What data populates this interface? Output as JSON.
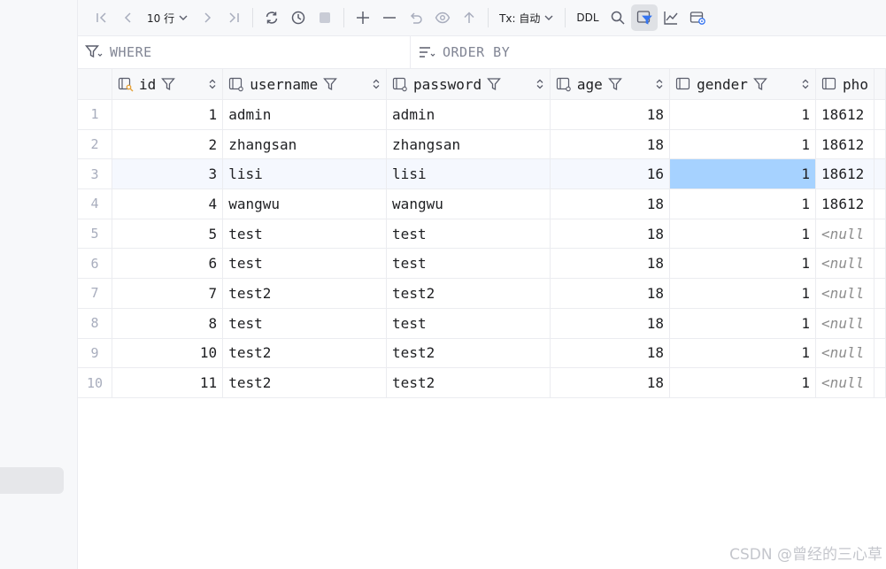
{
  "toolbar": {
    "page_size_label": "10 行",
    "tx_label": "Tx: 自动",
    "ddl_label": "DDL"
  },
  "filters": {
    "where_label": "WHERE",
    "order_by_label": "ORDER BY"
  },
  "table": {
    "columns": [
      {
        "name": "id",
        "key": true
      },
      {
        "name": "username"
      },
      {
        "name": "password"
      },
      {
        "name": "age"
      },
      {
        "name": "gender"
      },
      {
        "name": "pho"
      }
    ],
    "rows": [
      {
        "row": "1",
        "id": "1",
        "username": "admin",
        "password": "admin",
        "age": "18",
        "gender": "1",
        "phone": "18612"
      },
      {
        "row": "2",
        "id": "2",
        "username": "zhangsan",
        "password": "zhangsan",
        "age": "18",
        "gender": "1",
        "phone": "18612"
      },
      {
        "row": "3",
        "id": "3",
        "username": "lisi",
        "password": "lisi",
        "age": "16",
        "gender": "1",
        "phone": "18612"
      },
      {
        "row": "4",
        "id": "4",
        "username": "wangwu",
        "password": "wangwu",
        "age": "18",
        "gender": "1",
        "phone": "18612"
      },
      {
        "row": "5",
        "id": "5",
        "username": "test",
        "password": "test",
        "age": "18",
        "gender": "1",
        "phone": "<null"
      },
      {
        "row": "6",
        "id": "6",
        "username": "test",
        "password": "test",
        "age": "18",
        "gender": "1",
        "phone": "<null"
      },
      {
        "row": "7",
        "id": "7",
        "username": "test2",
        "password": "test2",
        "age": "18",
        "gender": "1",
        "phone": "<null"
      },
      {
        "row": "8",
        "id": "8",
        "username": "test",
        "password": "test",
        "age": "18",
        "gender": "1",
        "phone": "<null"
      },
      {
        "row": "9",
        "id": "10",
        "username": "test2",
        "password": "test2",
        "age": "18",
        "gender": "1",
        "phone": "<null"
      },
      {
        "row": "10",
        "id": "11",
        "username": "test2",
        "password": "test2",
        "age": "18",
        "gender": "1",
        "phone": "<null"
      }
    ],
    "selected_row": 3,
    "selected_column": "gender"
  },
  "colors": {
    "selected_cell": "#a6d2ff",
    "selected_row": "#f5f8fe",
    "key_icon_accent": "#e5a23a"
  },
  "watermark": "CSDN @曾经的三心草"
}
